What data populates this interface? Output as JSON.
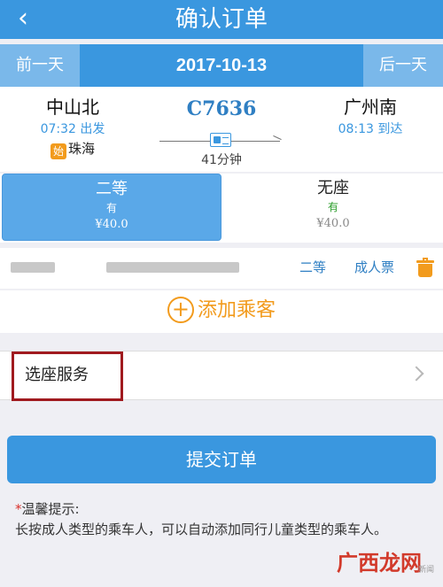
{
  "header": {
    "title": "确认订单",
    "back_icon": "chevron-left-icon"
  },
  "datebar": {
    "prev_label": "前一天",
    "date": "2017-10-13",
    "next_label": "后一天"
  },
  "train": {
    "number": "C7636",
    "duration": "41分钟",
    "departure": {
      "station": "中山北",
      "time": "07:32 出发",
      "origin_badge": "始",
      "origin_name": "珠海"
    },
    "arrival": {
      "station": "广州南",
      "time": "08:13 到达"
    }
  },
  "seats": [
    {
      "name": "二等",
      "availability": "有",
      "price": "¥40.0",
      "selected": true
    },
    {
      "name": "无座",
      "availability": "有",
      "price": "¥40.0",
      "selected": false
    }
  ],
  "passenger": {
    "seat_class": "二等",
    "ticket_type": "成人票"
  },
  "add_passenger": {
    "icon": "plus-circle-icon",
    "label": "添加乘客"
  },
  "service": {
    "label": "选座服务"
  },
  "submit": {
    "label": "提交订单"
  },
  "tip": {
    "star": "*",
    "title": "温馨提示:",
    "text": "长按成人类型的乘车人，可以自动添加同行儿童类型的乘车人。"
  },
  "watermark": {
    "logo": "广西龙网",
    "small": "新闻"
  },
  "colors": {
    "primary": "#3a97df",
    "accent": "#f29b1d",
    "highlight": "#a01a1f"
  }
}
